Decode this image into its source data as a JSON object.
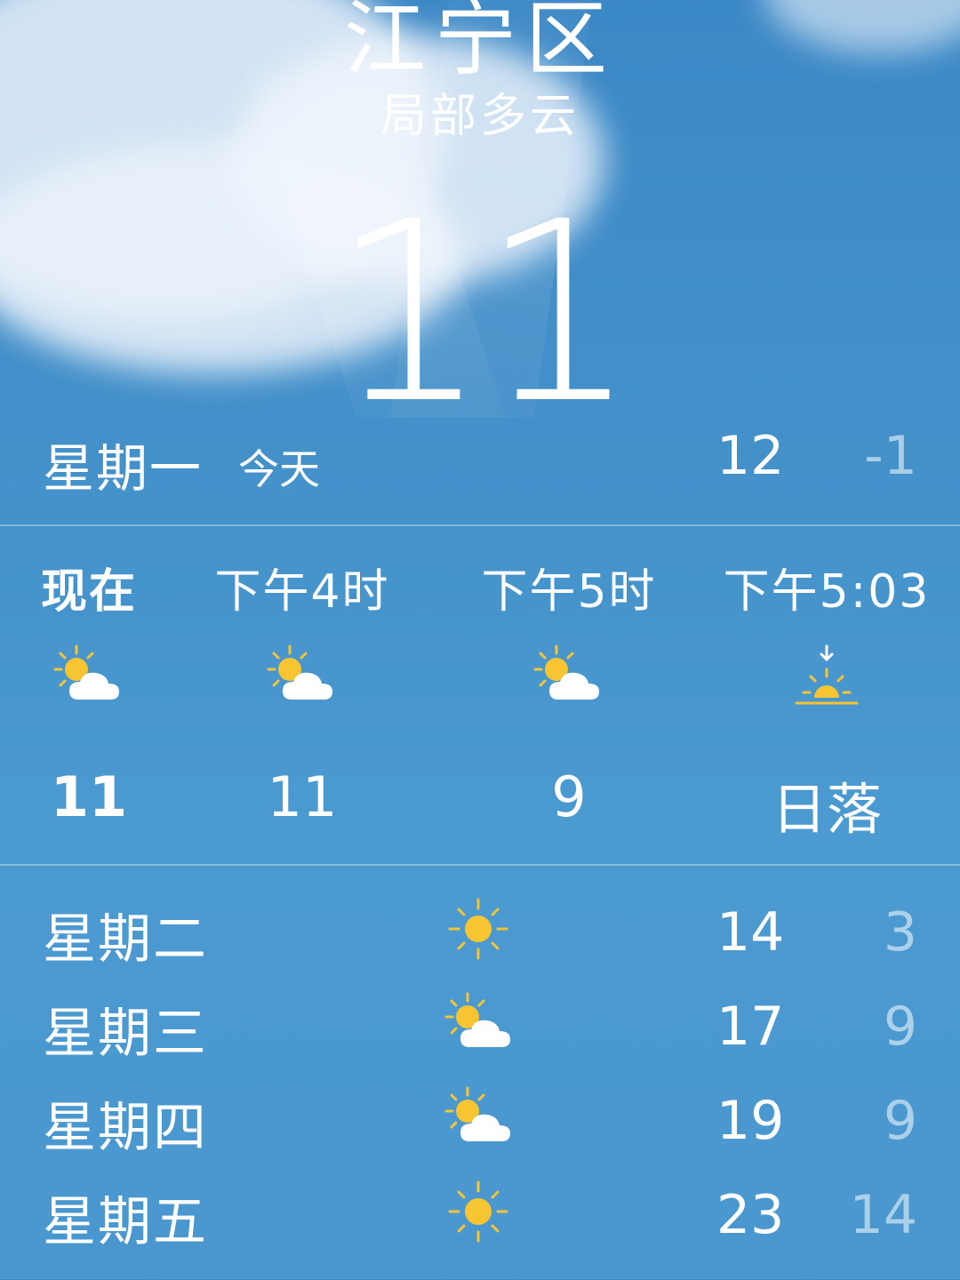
{
  "header": {
    "city": "江宁区",
    "condition": "局部多云",
    "current_temp": "11"
  },
  "today": {
    "day": "星期一",
    "label": "今天",
    "high": "12",
    "low": "-1"
  },
  "hourly": [
    {
      "time": "现在",
      "icon": "partly-cloudy-icon",
      "temp": "11"
    },
    {
      "time": "下午4时",
      "icon": "partly-cloudy-icon",
      "temp": "11"
    },
    {
      "time": "下午5时",
      "icon": "partly-cloudy-icon",
      "temp": "9"
    },
    {
      "time": "下午5:03",
      "icon": "sunset-icon",
      "temp": "日落"
    }
  ],
  "daily": [
    {
      "day": "星期二",
      "icon": "sun-icon",
      "high": "14",
      "low": "3"
    },
    {
      "day": "星期三",
      "icon": "partly-cloudy-icon",
      "high": "17",
      "low": "9"
    },
    {
      "day": "星期四",
      "icon": "partly-cloudy-icon",
      "high": "19",
      "low": "9"
    },
    {
      "day": "星期五",
      "icon": "sun-icon",
      "high": "23",
      "low": "14"
    }
  ],
  "colors": {
    "sky": "#4592cb",
    "sun": "#f7c531",
    "cloud": "#ffffff"
  }
}
